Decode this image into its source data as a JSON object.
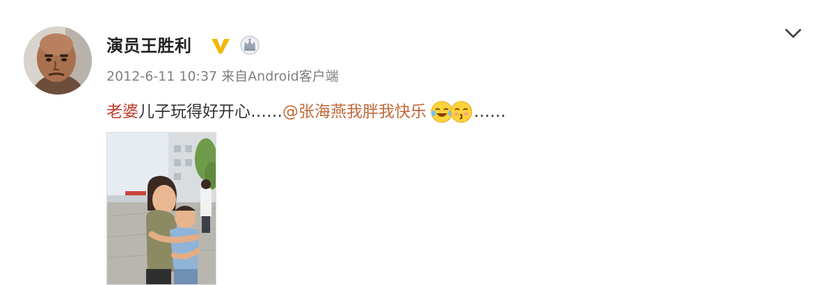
{
  "post": {
    "author_name": "演员王胜利",
    "verified_icon": "verified-v-icon",
    "crown_icon": "crown-icon",
    "timestamp": "2012-6-11 10:37",
    "source_prefix": "来自",
    "source": "Android客户端",
    "text_highlight": "老婆",
    "text_body": "儿子玩得好开心……",
    "mention": "@张海燕我胖我快乐",
    "text_tail": "……",
    "emojis": [
      "laughing-tears-emoji",
      "kiss-emoji"
    ],
    "more_icon": "chevron-down-icon"
  },
  "colors": {
    "name": "#222222",
    "meta": "#7f7f7f",
    "highlight": "#c0392b",
    "mention": "#c06a3a",
    "verified": "#f2b705"
  }
}
